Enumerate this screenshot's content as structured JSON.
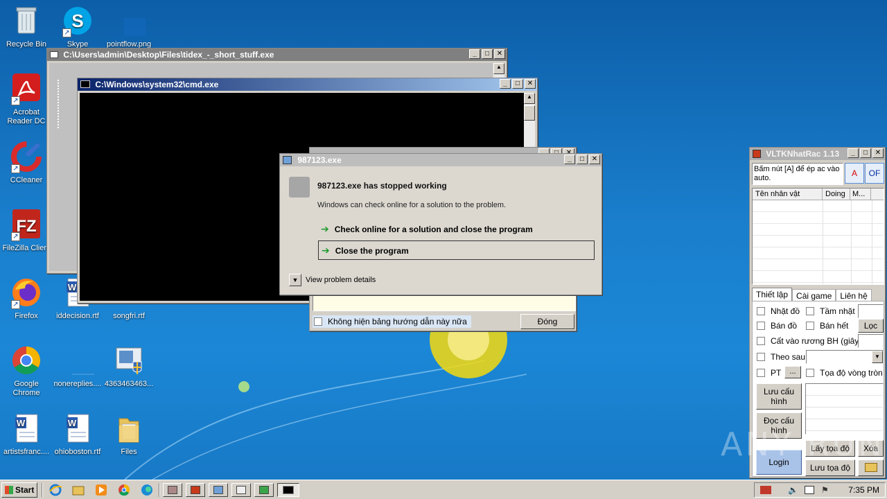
{
  "desktop": {
    "icons": [
      {
        "label": "Recycle Bin"
      },
      {
        "label": "Skype"
      },
      {
        "label": "pointflow.png"
      },
      {
        "label": "Acrobat Reader DC"
      },
      {
        "label": "CCleaner"
      },
      {
        "label": "FileZilla Client"
      },
      {
        "label": "Firefox"
      },
      {
        "label": "iddecision.rtf"
      },
      {
        "label": "songfri.rtf"
      },
      {
        "label": "Google Chrome"
      },
      {
        "label": "nonereplies...."
      },
      {
        "label": "4363463463..."
      },
      {
        "label": "artistsfranc...."
      },
      {
        "label": "ohioboston.rtf"
      },
      {
        "label": "Files"
      }
    ]
  },
  "windows": {
    "tidex": {
      "title": "C:\\Users\\admin\\Desktop\\Files\\tidex_-_short_stuff.exe"
    },
    "cmd": {
      "title": "C:\\Windows\\system32\\cmd.exe"
    },
    "helper": {
      "checkbox_label": "Không hiện bảng hướng dẫn này nữa",
      "button_label": "Đóng"
    },
    "error": {
      "title": "987123.exe",
      "heading": "987123.exe has stopped working",
      "message": "Windows can check online for a solution to the problem.",
      "option1": "Check online for a solution and close the program",
      "option2": "Close the program",
      "details": "View problem details"
    },
    "vltk": {
      "title": "VLTKNhatRac 1.13",
      "info": "Bấm nút [A] để ép ac vào auto.",
      "btn_a": "A",
      "btn_of": "OF",
      "columns": [
        "Tên nhân vật",
        "Doing",
        "M..."
      ],
      "tabs": [
        "Thiết lập",
        "Cài game",
        "Liên hệ"
      ],
      "opt_nhat_do": "Nhặt đồ",
      "opt_tam_nhat": "Tầm nhặt",
      "opt_ban_do": "Bán đồ",
      "opt_ban_het": "Bán hết",
      "btn_loc": "Lọc",
      "opt_cat_vao": "Cất vào rương BH (giây)",
      "opt_theo_sau": "Theo sau",
      "opt_pt": "PT",
      "btn_dots": "...",
      "opt_toa_do": "Tọa độ vòng tròn",
      "btn_luu_cau_hinh": "Lưu cấu hình",
      "btn_doc_cau_hinh": "Đọc cấu hình",
      "btn_lay_toa_do": "Lấy tọa độ",
      "btn_xoa": "Xóa",
      "btn_login": "Login",
      "btn_luu_toa_do": "Lưu tọa độ"
    }
  },
  "watermark": "ANY RUN",
  "taskbar": {
    "start_label": "Start",
    "time": "7:35 PM"
  },
  "colors": {
    "desktop": "#1a7fcd",
    "chrome": "#d4d0c8",
    "title_active": "#0a246a"
  }
}
